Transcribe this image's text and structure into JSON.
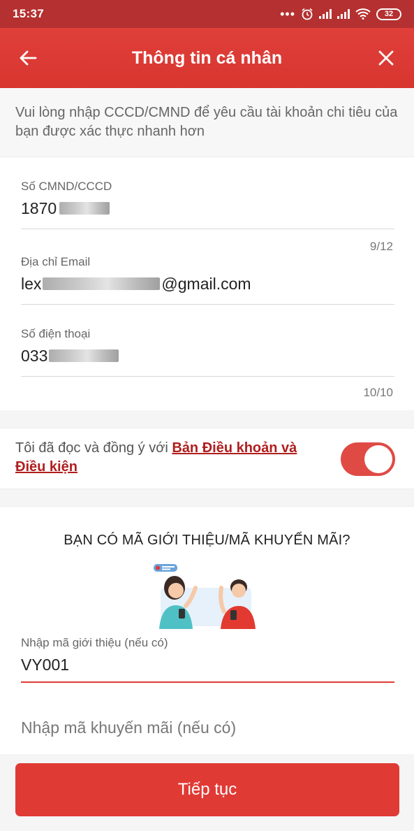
{
  "status_bar": {
    "time": "15:37",
    "battery": "32"
  },
  "header": {
    "title": "Thông tin cá nhân"
  },
  "intro": {
    "text": "Vui lòng nhập CCCD/CMND để yêu cầu tài khoản chi tiêu của bạn được xác thực nhanh hơn"
  },
  "form": {
    "id_number": {
      "label": "Số CMND/CCCD",
      "value_prefix": "1870",
      "counter": "9/12"
    },
    "email": {
      "label": "Địa chỉ Email",
      "value_prefix": "lex",
      "value_suffix": "@gmail.com"
    },
    "phone": {
      "label": "Số điện thoại",
      "value_prefix": "033",
      "counter": "10/10"
    }
  },
  "terms": {
    "text": "Tôi đã đọc và đồng ý với ",
    "link": "Bản Điều khoản và Điều kiện",
    "toggle_on": true
  },
  "promo": {
    "heading": "BẠN CÓ MÃ GIỚI THIỆU/MÃ KHUYẾN MÃI?",
    "referral": {
      "label": "Nhập mã giới thiệu (nếu có)",
      "value": "VY001"
    },
    "promo_code": {
      "placeholder": "Nhập mã khuyến mãi (nếu có)"
    }
  },
  "cta": {
    "label": "Tiếp tục"
  },
  "colors": {
    "primary": "#e03a35",
    "status_bar": "#b53030",
    "link": "#b01e1e"
  }
}
